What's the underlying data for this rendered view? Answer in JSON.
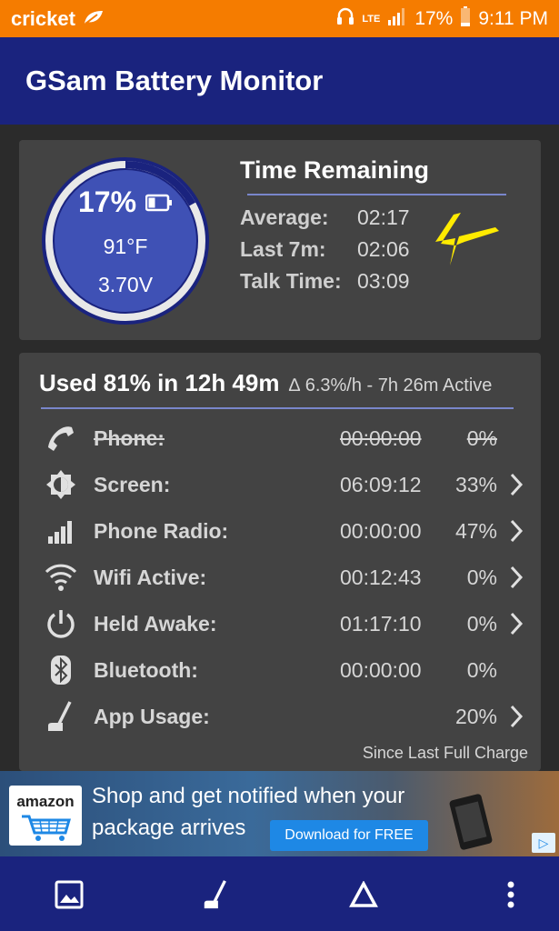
{
  "status_bar": {
    "carrier": "cricket",
    "network": "LTE",
    "battery_percent": "17%",
    "time": "9:11 PM"
  },
  "app": {
    "title": "GSam Battery Monitor"
  },
  "gauge": {
    "percent": "17%",
    "level": 0.17,
    "temperature": "91°F",
    "voltage": "3.70V"
  },
  "time_remaining": {
    "title": "Time Remaining",
    "rows": [
      {
        "label": "Average:",
        "value": "02:17"
      },
      {
        "label": "Last 7m:",
        "value": "02:06"
      },
      {
        "label": "Talk Time:",
        "value": "03:09"
      }
    ]
  },
  "usage": {
    "summary": "Used 81% in 12h 49m",
    "rate": "∆ 6.3%/h - 7h 26m Active",
    "rows": [
      {
        "icon": "phone-icon",
        "label": "Phone:",
        "time": "00:00:00",
        "pct": "0%",
        "chevron": false,
        "disabled": true
      },
      {
        "icon": "screen-brightness-icon",
        "label": "Screen:",
        "time": "06:09:12",
        "pct": "33%",
        "chevron": true,
        "disabled": false
      },
      {
        "icon": "signal-bars-icon",
        "label": "Phone Radio:",
        "time": "00:00:00",
        "pct": "47%",
        "chevron": true,
        "disabled": false
      },
      {
        "icon": "wifi-icon",
        "label": "Wifi Active:",
        "time": "00:12:43",
        "pct": "0%",
        "chevron": true,
        "disabled": false
      },
      {
        "icon": "power-icon",
        "label": "Held Awake:",
        "time": "01:17:10",
        "pct": "0%",
        "chevron": true,
        "disabled": false
      },
      {
        "icon": "bluetooth-icon",
        "label": "Bluetooth:",
        "time": "00:00:00",
        "pct": "0%",
        "chevron": false,
        "disabled": false
      },
      {
        "icon": "app-usage-icon",
        "label": "App Usage:",
        "time": "",
        "pct": "20%",
        "chevron": true,
        "disabled": false
      }
    ],
    "footer": "Since Last Full Charge"
  },
  "ad": {
    "brand": "amazon",
    "line1": "Shop and get notified when your",
    "line2": "package arrives",
    "cta": "Download for FREE"
  },
  "colors": {
    "status_bar": "#f57c00",
    "app_bar": "#1a237e",
    "card": "#434343",
    "accent_line": "#7986cb",
    "gauge_fill": "#3f51b5"
  },
  "bottom_nav": [
    "gallery-icon",
    "app-usage-icon",
    "delta-icon",
    "more-vert-icon"
  ]
}
